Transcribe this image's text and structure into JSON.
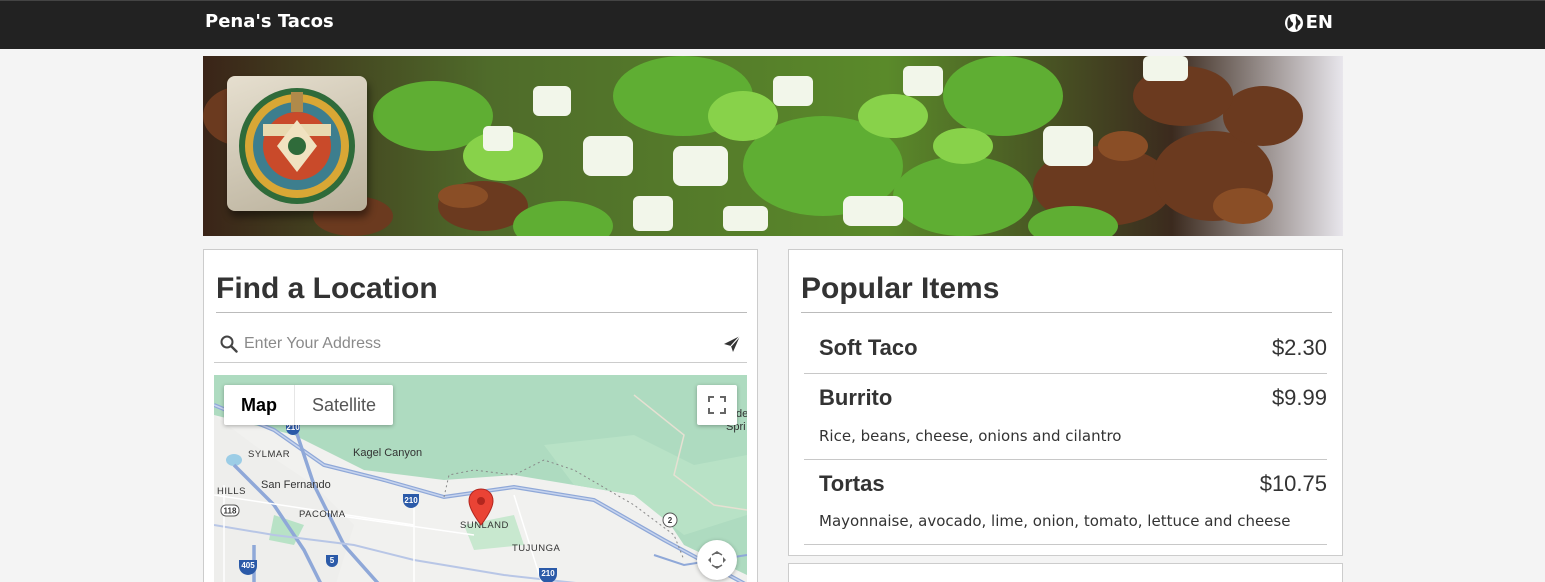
{
  "header": {
    "brand": "Pena's Tacos",
    "language": "EN",
    "language_icon": "globe-icon"
  },
  "banner": {
    "logo_icon": "restaurant-logo"
  },
  "location": {
    "title": "Find a Location",
    "search_placeholder": "Enter Your Address",
    "search_value": "",
    "search_icon": "search-icon",
    "submit_icon": "send-icon",
    "map": {
      "type_options": [
        "Map",
        "Satellite"
      ],
      "selected_type": "Map",
      "fullscreen_icon": "fullscreen-icon",
      "camera_icon": "camera-control-icon",
      "labels": [
        "SYLMAR",
        "Kagel Canyon",
        "HILLS",
        "San Fernando",
        "PACOIMA",
        "SUNLAND",
        "TUJUNGA",
        "Spri",
        "de"
      ],
      "shields": [
        "210",
        "118",
        "405",
        "5",
        "2"
      ]
    }
  },
  "popular": {
    "title": "Popular Items",
    "items": [
      {
        "name": "Soft Taco",
        "price": "$2.30",
        "description": ""
      },
      {
        "name": "Burrito",
        "price": "$9.99",
        "description": "Rice, beans, cheese, onions and cilantro"
      },
      {
        "name": "Tortas",
        "price": "$10.75",
        "description": "Mayonnaise, avocado, lime, onion, tomato, lettuce and cheese"
      }
    ]
  },
  "colors": {
    "topbar": "#222222",
    "map_green": "#aedbc0",
    "pin_red": "#ea4335"
  }
}
